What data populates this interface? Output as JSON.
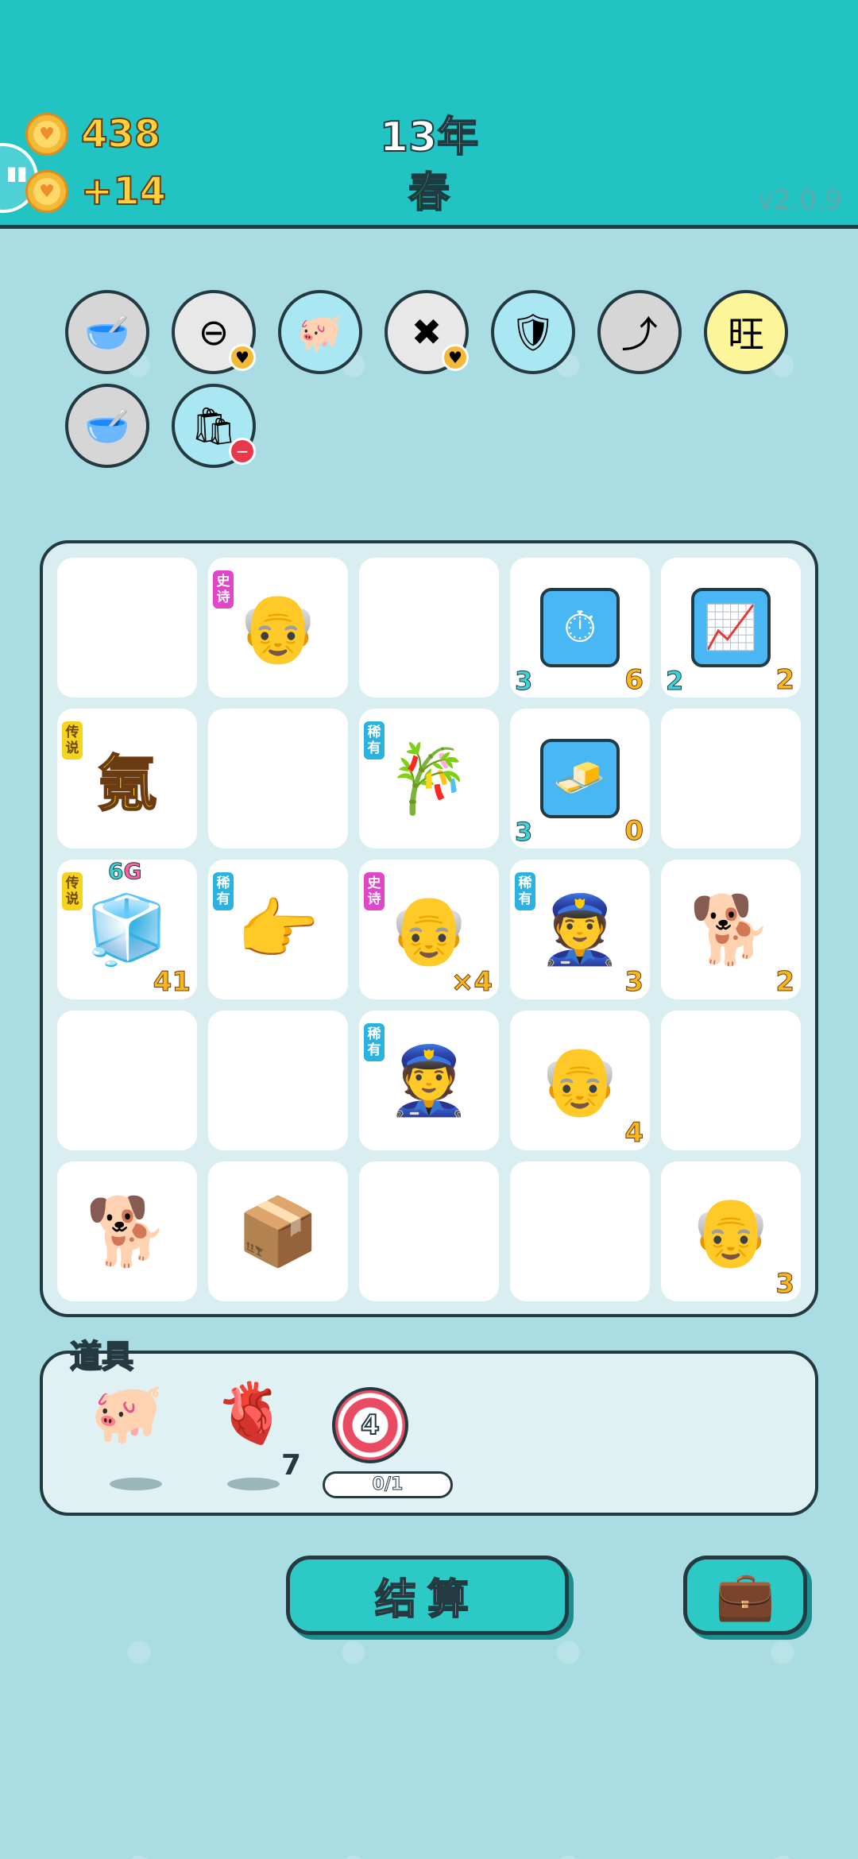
{
  "header": {
    "coins": "438",
    "income": "+14",
    "year": "13年",
    "season": "春",
    "version": "v2.0.9"
  },
  "buffs": [
    {
      "name": "pet-food-bowl-icon",
      "glyph": "🥣",
      "bg": "#d6d6d6"
    },
    {
      "name": "no-entry-icon",
      "glyph": "⊖",
      "bg": "#e8e8e8"
    },
    {
      "name": "piggy-bank-icon",
      "glyph": "🐖",
      "bg": "#a9e7f2"
    },
    {
      "name": "delete-tag-icon",
      "glyph": "✖",
      "bg": "#e8e8e8"
    },
    {
      "name": "shield-wrench-icon",
      "glyph": "🛡",
      "bg": "#a9e7f2"
    },
    {
      "name": "arrow-up-card-icon",
      "glyph": "⤴",
      "bg": "#d6d6d6"
    },
    {
      "name": "wang-character-icon",
      "glyph": "旺",
      "bg": "#fdf59a"
    },
    {
      "name": "pet-food-bowl-icon-2",
      "glyph": "🥣",
      "bg": "#d6d6d6"
    },
    {
      "name": "trash-bag-icon",
      "glyph": "🛍",
      "bg": "#a9e7f2"
    }
  ],
  "board": {
    "cells": [
      {
        "glyph": ""
      },
      {
        "glyph": "👴",
        "tag": "史诗",
        "tag_type": "epic"
      },
      {
        "glyph": ""
      },
      {
        "glyph": "⏱",
        "box": true,
        "bl": "3",
        "br": "6"
      },
      {
        "glyph": "📈",
        "box": true,
        "bl": "2",
        "br": "2"
      },
      {
        "glyph": "氪",
        "big": true,
        "tag": "传说",
        "tag_type": "legend"
      },
      {
        "glyph": ""
      },
      {
        "glyph": "🎋",
        "tag": "稀有",
        "tag_type": "rare"
      },
      {
        "glyph": "🧈",
        "box": true,
        "bl": "3",
        "br": "0"
      },
      {
        "glyph": ""
      },
      {
        "glyph": "🧊",
        "tag": "传说",
        "tag_type": "legend",
        "tl": "6G",
        "br": "41"
      },
      {
        "glyph": "👉",
        "tag": "稀有",
        "tag_type": "rare"
      },
      {
        "glyph": "👴",
        "tag": "史诗",
        "tag_type": "epic",
        "br": "×4"
      },
      {
        "glyph": "👮",
        "tag": "稀有",
        "tag_type": "rare",
        "br": "3"
      },
      {
        "glyph": "🐕",
        "br": "2"
      },
      {
        "glyph": ""
      },
      {
        "glyph": ""
      },
      {
        "glyph": "👮",
        "tag": "稀有",
        "tag_type": "rare"
      },
      {
        "glyph": "👴",
        "br": "4"
      },
      {
        "glyph": ""
      },
      {
        "glyph": "🐕"
      },
      {
        "glyph": "📦"
      },
      {
        "glyph": ""
      },
      {
        "glyph": ""
      },
      {
        "glyph": "👴",
        "br": "3"
      }
    ]
  },
  "props": {
    "title": "道具",
    "liver_count": "7",
    "dart_value": "4",
    "dart_progress": "0/1"
  },
  "actions": {
    "settle_label": "结算"
  }
}
